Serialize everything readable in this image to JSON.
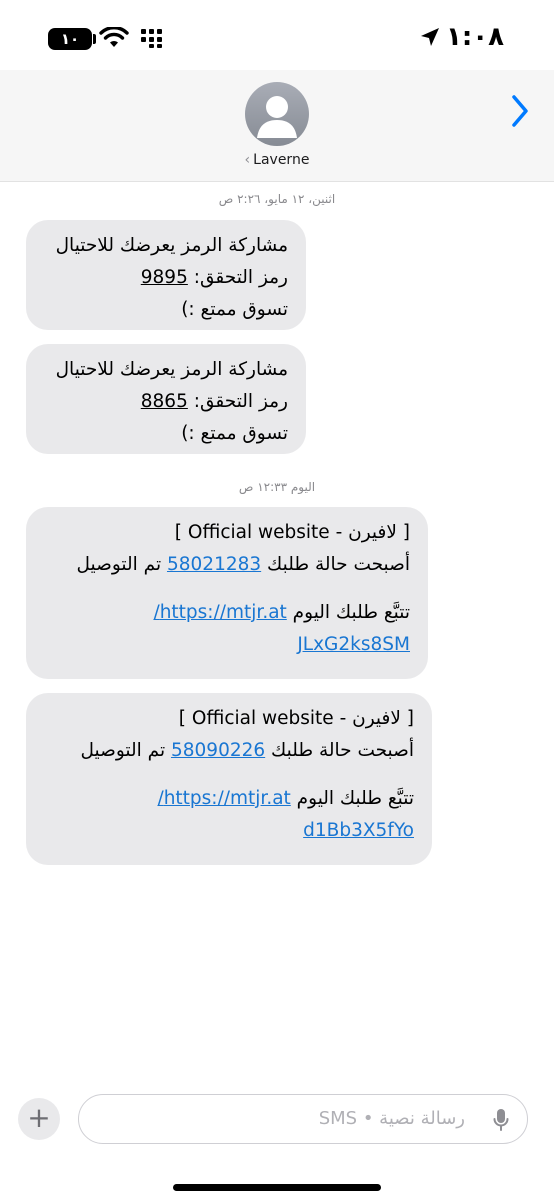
{
  "status_bar": {
    "time": "١:٠٨",
    "battery": "١٠"
  },
  "header": {
    "contact_name": "Laverne",
    "contact_chevron": "‹"
  },
  "thread": {
    "stamp_1": "اثنين، ١٢ مايو، ٢:٢٦ ص",
    "stamp_2": "اليوم ١٢:٣٣ ص",
    "messages": [
      {
        "line1": "مشاركة الرمز يعرضك للاحتيال",
        "line2_prefix": "رمز التحقق: ",
        "code": "9895",
        "line3": "تسوق ممتع :)"
      },
      {
        "line1": "مشاركة الرمز يعرضك للاحتيال",
        "line2_prefix": "رمز التحقق: ",
        "code": "8865",
        "line3": "تسوق ممتع :)"
      },
      {
        "line1": "[ لافيرن - Official website ]",
        "line2_prefix": "أصبحت حالة طلبك ",
        "order": "58021283",
        "line2_suffix": " تم التوصيل",
        "line3_prefix": "تتبَّع طلبك اليوم ",
        "url_part1": "https://mtjr.at/",
        "url_part2": "JLxG2ks8SM"
      },
      {
        "line1": "[ لافيرن - Official website ]",
        "line2_prefix": "أصبحت حالة طلبك ",
        "order": "58090226",
        "line2_suffix": " تم التوصيل",
        "line3_prefix": "تتبَّع طلبك اليوم ",
        "url_part1": "https://mtjr.at/",
        "url_part2": "d1Bb3X5fYo"
      }
    ]
  },
  "composer": {
    "plus_label": "+",
    "placeholder": "رسالة نصية • SMS"
  },
  "colors": {
    "bubble": "#e9e9eb",
    "link": "#1976d2",
    "accent": "#007aff"
  }
}
